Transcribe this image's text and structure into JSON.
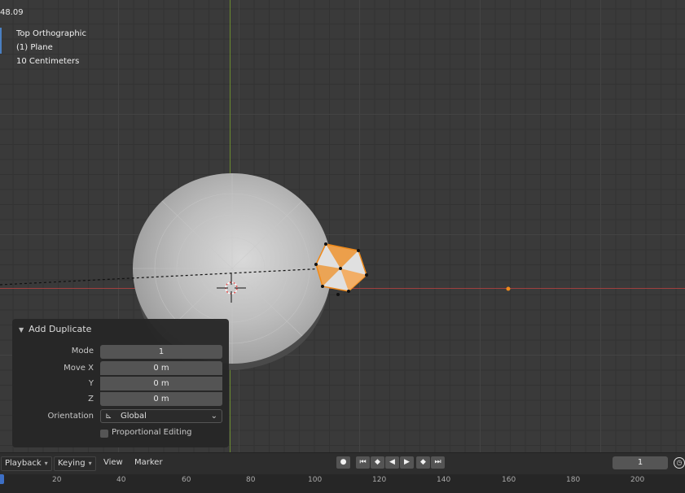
{
  "viewport": {
    "top_number": "48.09",
    "view_name": "Top Orthographic",
    "object_name": "(1) Plane",
    "scale_label": "10 Centimeters"
  },
  "redo_panel": {
    "title": "Add Duplicate",
    "mode_label": "Mode",
    "mode_value": "1",
    "move_x_label": "Move X",
    "move_x_value": "0 m",
    "y_label": "Y",
    "y_value": "0 m",
    "z_label": "Z",
    "z_value": "0 m",
    "orientation_label": "Orientation",
    "orientation_value": "Global",
    "proportional_editing_label": "Proportional Editing"
  },
  "timeline": {
    "playback_label": "Playback",
    "keying_label": "Keying",
    "view_label": "View",
    "marker_label": "Marker",
    "current_frame": "1",
    "ruler_ticks": [
      "20",
      "40",
      "60",
      "80",
      "100",
      "120",
      "140",
      "160",
      "180",
      "200"
    ]
  },
  "colors": {
    "selection_orange": "#f08a1a",
    "x_axis_red": "#a0403f",
    "y_axis_green": "#6a8a2f",
    "accent_blue": "#4a7fc1"
  }
}
